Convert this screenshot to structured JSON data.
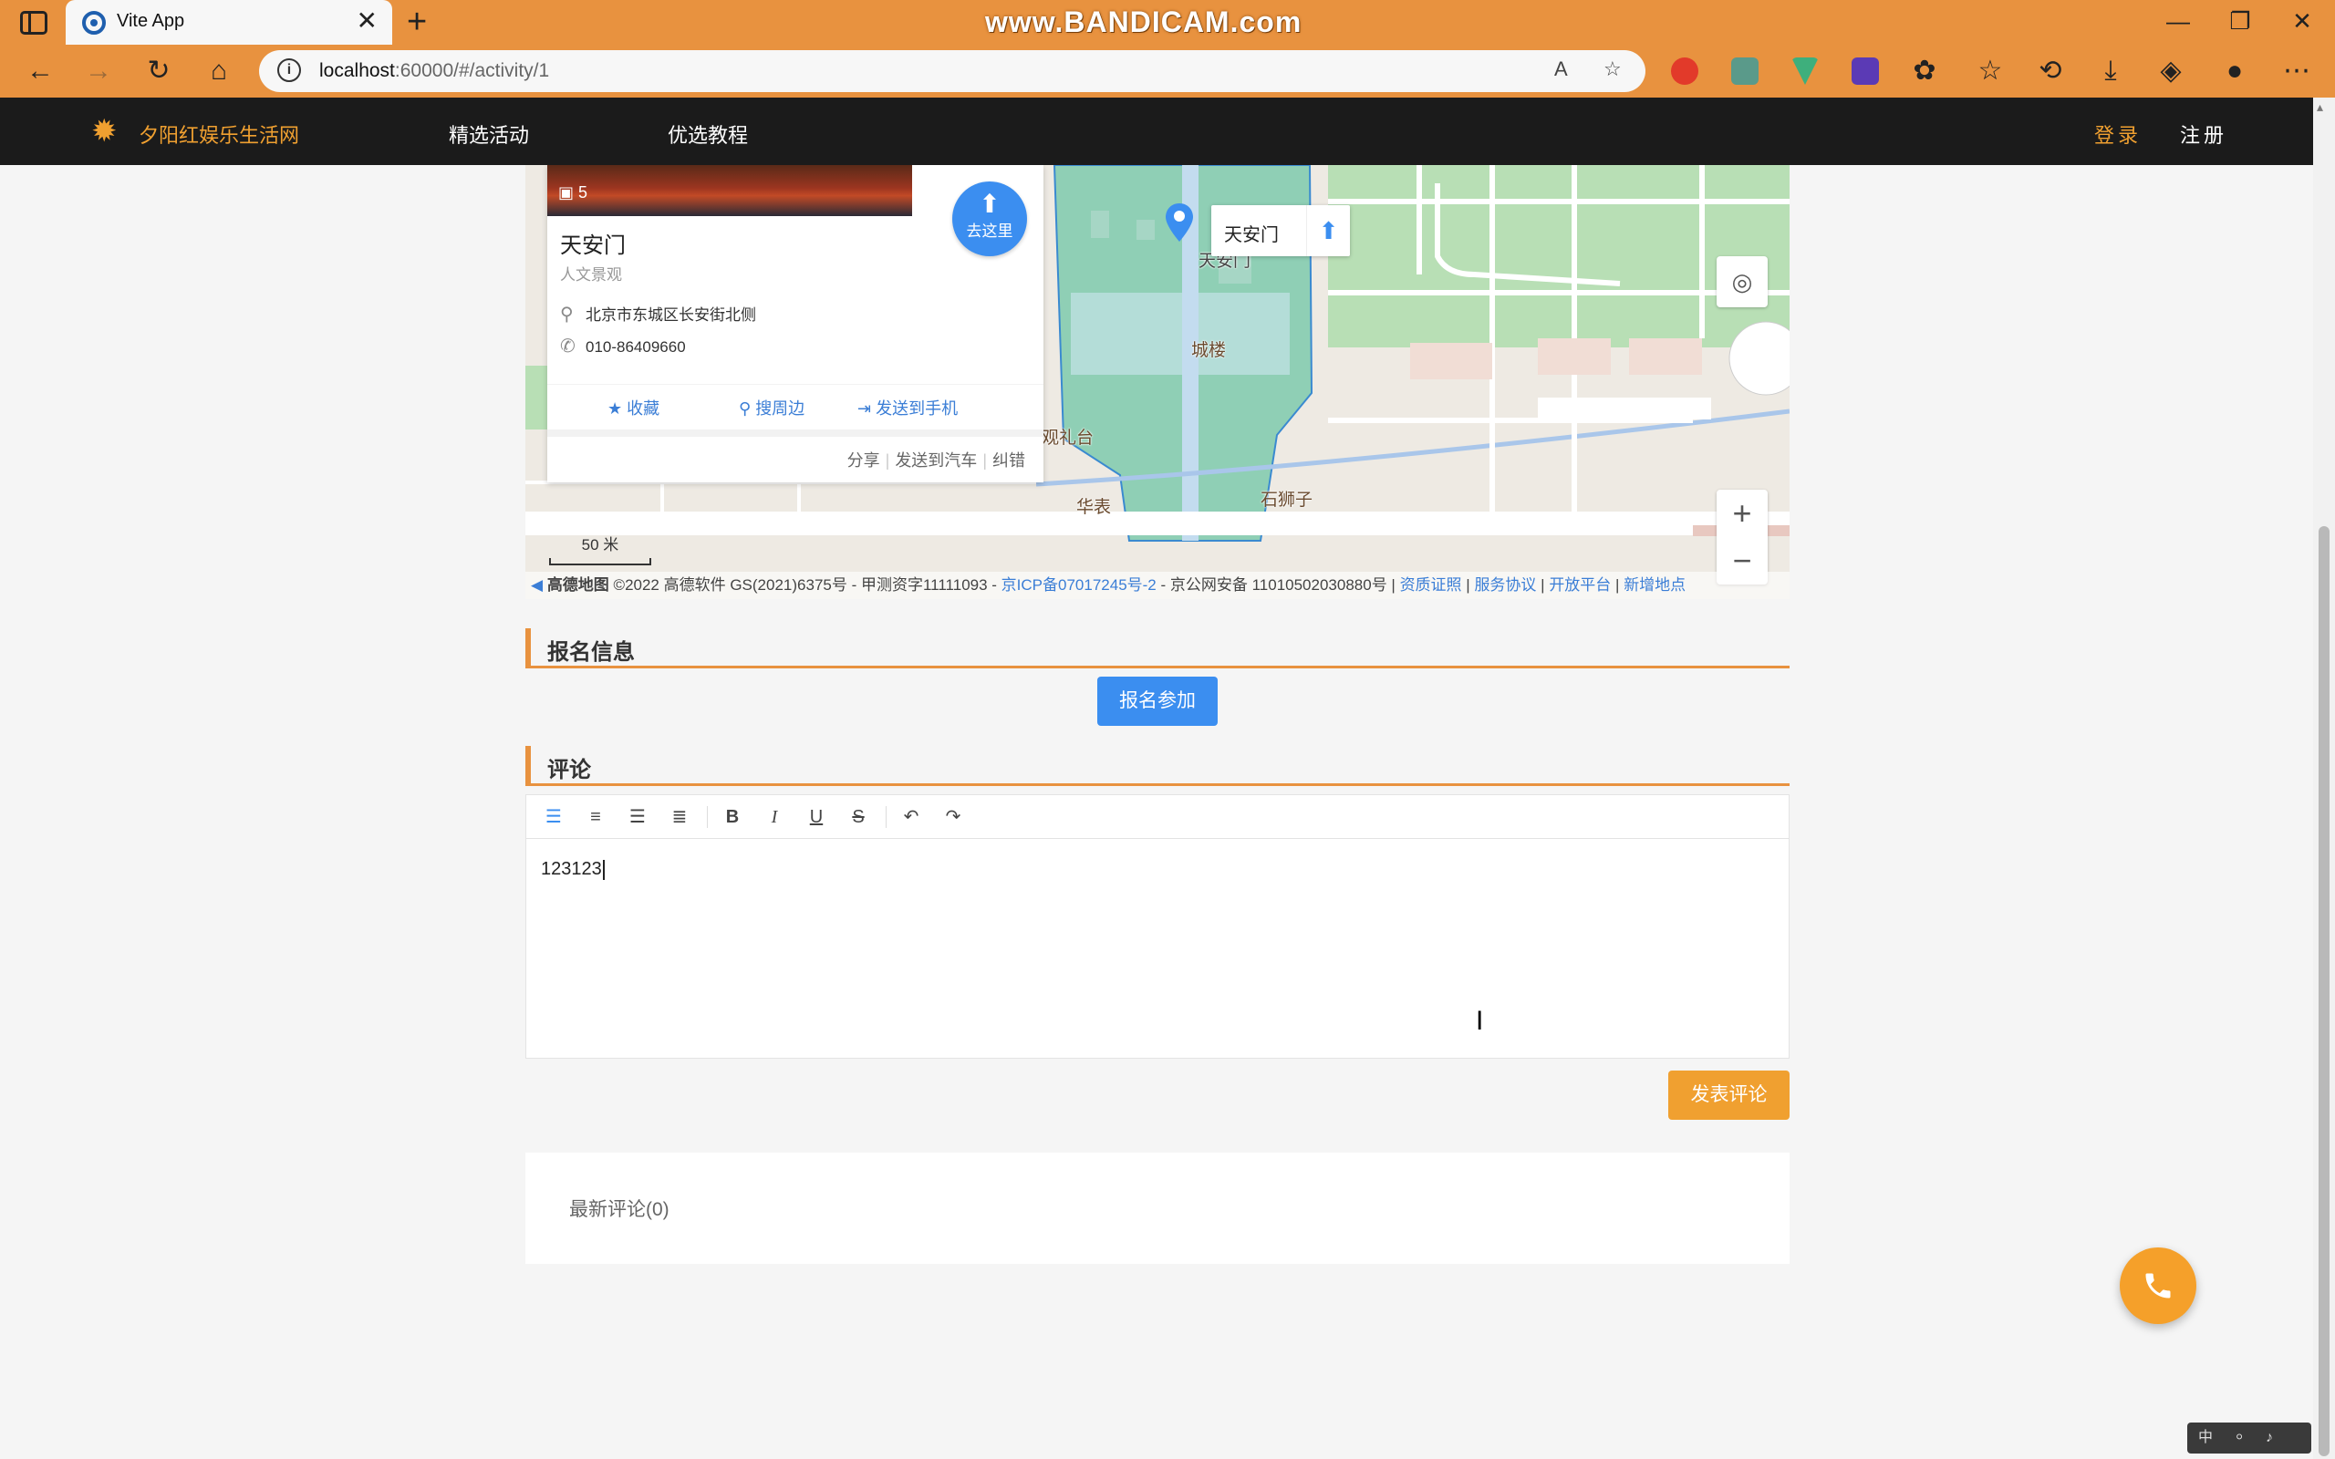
{
  "browser": {
    "tab_title": "Vite App",
    "tab_close": "✕",
    "new_tab": "+",
    "watermark": "www.BANDICAM.com",
    "address_host": "localhost",
    "address_path": ":60000/#/activity/1",
    "window_minimize": "—",
    "window_restore": "❐",
    "window_close": "✕"
  },
  "header": {
    "logo_text": "夕阳红娱乐生活网",
    "nav": [
      "精选活动",
      "优选教程"
    ],
    "login": "登录",
    "register": "注册"
  },
  "map": {
    "photo_count": "5",
    "goto_label": "去这里",
    "poi_name": "天安门",
    "poi_type": "人文景观",
    "address": "北京市东城区长安街北侧",
    "phone": "010-86409660",
    "actions": [
      "收藏",
      "搜周边",
      "发送到手机"
    ],
    "footer_links": [
      "分享",
      "发送到汽车",
      "纠错"
    ],
    "marker_popup": "天安门",
    "labels": [
      "观礼台",
      "城楼",
      "华表",
      "石狮子",
      "天安门"
    ],
    "scale": "50 米",
    "copyright_brand": "高德地图",
    "copyright_text": "©2022 高德软件 GS(2021)6375号 - 甲测资字11111093 - ",
    "copyright_icp": "京ICP备07017245号-2",
    "copyright_mid": " - 京公网安备 11010502030880号 | ",
    "copyright_links": [
      "资质证照",
      "服务协议",
      "开放平台",
      "新增地点"
    ],
    "colors": {
      "park_green": "#b8dfb5",
      "palace_teal": "#8fcfb5",
      "road_blue": "#a9c6ea",
      "map_bg": "#eeeae3"
    }
  },
  "signup": {
    "title": "报名信息",
    "button": "报名参加"
  },
  "comment": {
    "title": "评论",
    "editor_text": "123123",
    "post_button": "发表评论",
    "latest_label": "最新评论(0)"
  },
  "ime": "中 ⸰ ♪ ⌂",
  "colors": {
    "accent_orange": "#e8923f",
    "primary_blue": "#3b8ef0",
    "header_bg": "#1b1b1b",
    "post_orange": "#f0a030"
  }
}
